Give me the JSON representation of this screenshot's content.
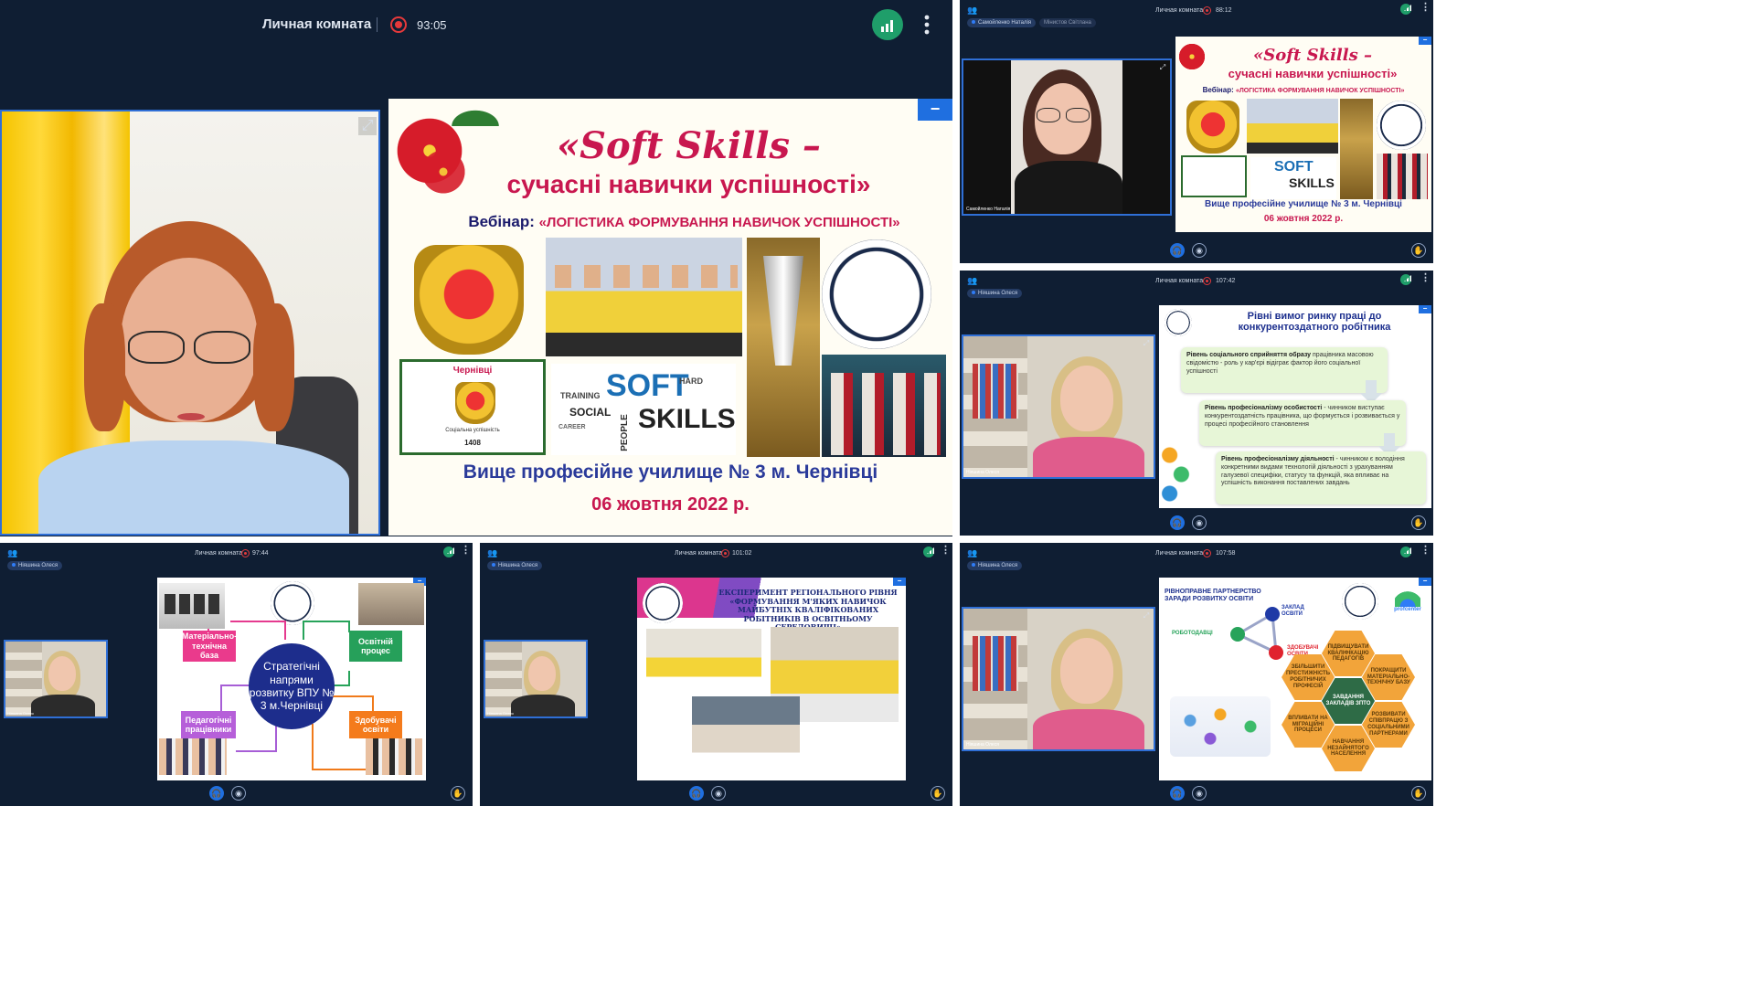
{
  "main_panel": {
    "room_title": "Личная комната",
    "timer": "93:05",
    "slide": {
      "title": "«Soft Skills –",
      "subtitle": "сучасні навички успішності»",
      "webinar_label": "Вебінар:",
      "webinar_topic": "«ЛОГІСТИКА ФОРМУВАННЯ НАВИЧОК УСПІШНОСТІ»",
      "city_badge": "Чернівці",
      "crest_caption": "Соціальна успішність",
      "year": "1408",
      "school": "Вище професійне училище № 3 м. Чернівці",
      "date": "06 жовтня 2022 р."
    }
  },
  "panel_top_right": {
    "room_title": "Личная комната",
    "timer": "88:12",
    "chips": [
      "Самойленко Наталія",
      "Мінистов Світлана"
    ],
    "camera_label": "Самойленко Наталія",
    "slide": {
      "title": "«Soft Skills –",
      "subtitle": "сучасні навички успішності»",
      "webinar_label": "Вебінар:",
      "webinar_topic": "«ЛОГІСТИКА ФОРМУВАННЯ НАВИЧОК УСПІШНОСТІ»",
      "school": "Вище професійне училище № 3 м. Чернівці",
      "date": "06 жовтня 2022 р."
    }
  },
  "panel_mid_right": {
    "room_title": "Личная комната",
    "timer": "107:42",
    "chip": "Ніяшина Олеся",
    "camera_label": "Ніяшина Олеся",
    "slide": {
      "title": "Рівні вимог ринку праці до конкурентоздатного робітника",
      "cards": [
        {
          "head": "Рівень соціального сприйняття образу",
          "body": "працівника масовою свідомістю - роль у кар'єрі відіграє фактор його соціальної успішності"
        },
        {
          "head": "Рівень професіоналізму особистості",
          "body": "- чинником виступає конкурентоздатність працівника, що формується і розвивається у процесі професійного становлення"
        },
        {
          "head": "Рівень професіоналізму діяльності",
          "body": "- чинником є володіння конкретними видами технологій діяльності з урахуванням галузевої специфіки, статусу та функцій, яка впливає на успішність виконання поставлених завдань"
        }
      ]
    }
  },
  "panel_bottom_left": {
    "room_title": "Личная комната",
    "timer": "97:44",
    "chip": "Ніяшина Олеся",
    "camera_label": "Ніяшина Олеся",
    "slide": {
      "center": "Стратегічні напрями розвитку ВПУ № 3 м.Чернівці",
      "boxes": [
        "Матеріально-технічна база",
        "Освітній процес",
        "Педагогічні працівники",
        "Здобувачі освіти"
      ]
    }
  },
  "panel_bottom_mid": {
    "room_title": "Личная комната",
    "timer": "101:02",
    "chip": "Ніяшина Олеся",
    "camera_label": "Ніяшина Олеся",
    "slide": {
      "title": "ЕКСПЕРИМЕНТ РЕГІОНАЛЬНОГО РІВНЯ «ФОРМУВАННЯ М'ЯКИХ НАВИЧОК МАЙБУТНІХ КВАЛІФІКОВАНИХ РОБІТНИКІВ В ОСВІТНЬОМУ СЕРЕДОВИЩІ»"
    }
  },
  "panel_bottom_right": {
    "room_title": "Личная комната",
    "timer": "107:58",
    "chip": "Ніяшина Олеся",
    "camera_label": "Ніяшина Олеся",
    "slide": {
      "title": "РІВНОПРАВНЕ ПАРТНЕРСТВО ЗАРАДИ РОЗВИТКУ ОСВІТИ",
      "nodes": [
        "ЗАКЛАД ОСВІТИ",
        "РОБОТОДАВЦІ",
        "ЗДОБУВАЧІ ОСВІТИ"
      ],
      "brand": "profcenter",
      "hexes": [
        "ПІДВИЩУВАТИ КВАЛІФІКАЦІЮ ПЕДАГОГІВ",
        "ЗБІЛЬШИТИ ПРЕСТИЖНІСТЬ РОБІТНИЧИХ ПРОФЕСІЙ",
        "ПОКРАЩИТИ МАТЕРІАЛЬНО-ТЕХНІЧНУ БАЗУ",
        "ЗАВДАННЯ ЗАКЛАДІВ ЗПТО",
        "ВПЛИВАТИ НА МІГРАЦІЙНІ ПРОЦЕСИ",
        "РОЗВИВАТИ СПІВПРАЦЮ З СОЦІАЛЬНИМИ ПАРТНЕРАМИ",
        "НАВЧАННЯ НЕЗАЙНЯТОГО НАСЕЛЕННЯ"
      ]
    }
  },
  "colors": {
    "bg": "#0f1e33",
    "accent": "#1f6fe0",
    "slide_red": "#c8174f",
    "slide_blue": "#2a3a9a"
  },
  "icons": [
    "people-icon",
    "record-icon",
    "signal-icon",
    "more-icon",
    "expand-icon",
    "minimize-icon",
    "headset-icon",
    "camera-off-icon",
    "hand-icon"
  ]
}
